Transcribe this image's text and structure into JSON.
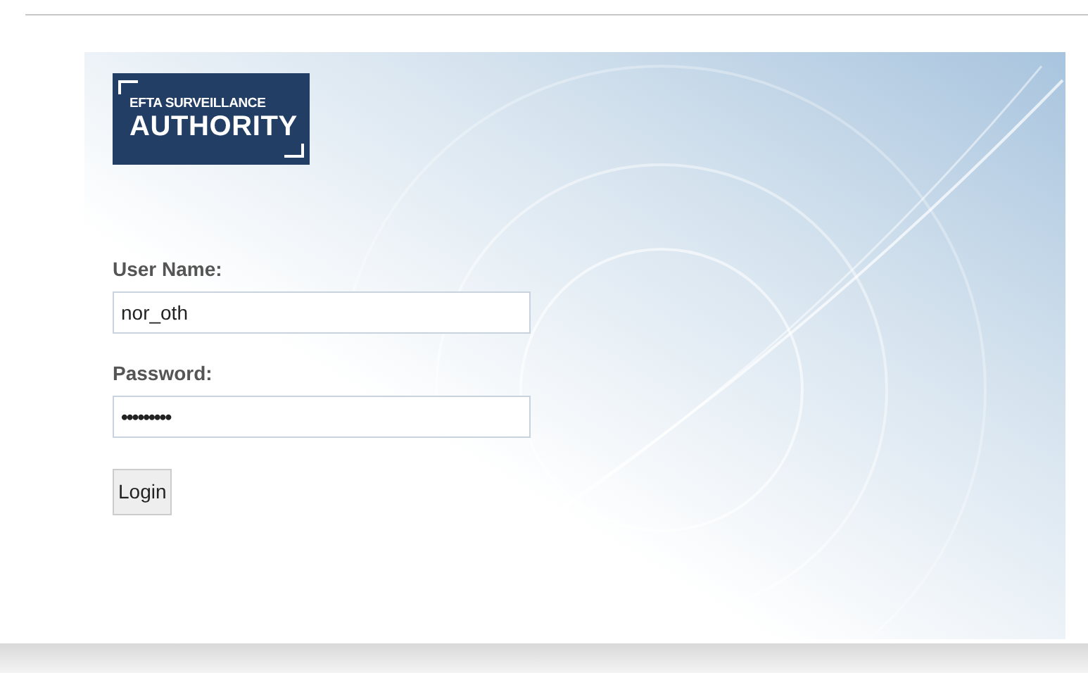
{
  "logo": {
    "line_1": "EFTA SURVEILLANCE",
    "line_2": "AUTHORITY"
  },
  "fields": [
    {
      "label": "User Name:",
      "value": "nor_oth",
      "kind": "text"
    },
    {
      "label": "Password:",
      "value": "•••••••••",
      "kind": "password"
    }
  ],
  "button": "Login"
}
